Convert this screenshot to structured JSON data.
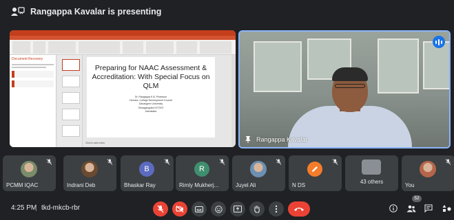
{
  "topbar": {
    "presenting_text": "Rangappa Kavalar is presenting"
  },
  "presentation": {
    "slide_title": "Preparing for NAAC Assessment & Accreditation: With Special Focus on QLM",
    "slide_lines": [
      "Dr. Rangappa K B, Professor",
      "Director, College Development Council",
      "Davangere University",
      "Shivagangothri 577007",
      "Karnataka"
    ],
    "recovery_title": "Document Recovery",
    "status_text": "Click to add notes"
  },
  "camera": {
    "name": "Rangappa Kavalar",
    "accent": "#8ab4f8"
  },
  "participants": [
    {
      "name": "PCMM IQAC",
      "kind": "photo",
      "color": "#7a8c6a"
    },
    {
      "name": "Indrani Deb",
      "kind": "photo",
      "color": "#6b4a2f"
    },
    {
      "name": "Bhaskar Ray",
      "kind": "letter",
      "letter": "B",
      "color": "#5c6bc0"
    },
    {
      "name": "Rimly Mukherj...",
      "kind": "letter",
      "letter": "R",
      "color": "#3f8f6f"
    },
    {
      "name": "Juyel Ali",
      "kind": "photo",
      "color": "#6d8fb2"
    },
    {
      "name": "N DS",
      "kind": "icon",
      "color": "#f57c2b"
    },
    {
      "name": "43 others",
      "kind": "group",
      "color": "#8a8f95"
    },
    {
      "name": "You",
      "kind": "photo",
      "color": "#b5654a"
    }
  ],
  "bottombar": {
    "time": "4:25 PM",
    "separator": "|",
    "meeting_code": "tkd-mkcb-rbr",
    "people_count": "52"
  },
  "colors": {
    "background": "#202124",
    "tile": "#3c4043",
    "end_call": "#ea4335"
  }
}
